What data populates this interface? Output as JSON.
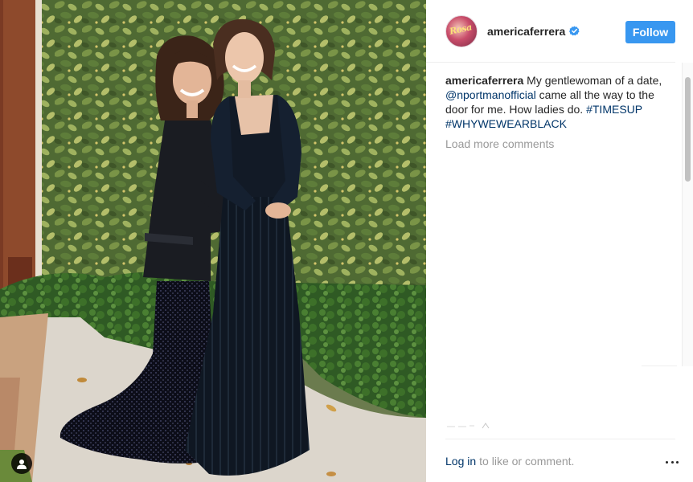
{
  "post": {
    "username": "americaferrera",
    "avatar_text": "Rosa",
    "verified": true,
    "follow_label": "Follow",
    "caption": {
      "username": "americaferrera",
      "text_part1": " My gentlewoman of a date, ",
      "mention": "@nportmanofficial",
      "text_part2": " came all the way to the door for me. How ladies do. ",
      "hashtag1": "#TIMESUP",
      "hashtag2": "#WHYWEWEARBLACK"
    },
    "load_more_label": "Load more comments",
    "footer": {
      "login_label": "Log in",
      "login_suffix": "to like or comment."
    }
  },
  "icons": {
    "user_tag": "user-tag-icon",
    "verified": "verified-badge-icon",
    "more": "more-options-icon"
  },
  "colors": {
    "follow_button": "#3897f0",
    "link": "#003569",
    "muted_text": "#999999",
    "verified_badge": "#3897f0"
  }
}
